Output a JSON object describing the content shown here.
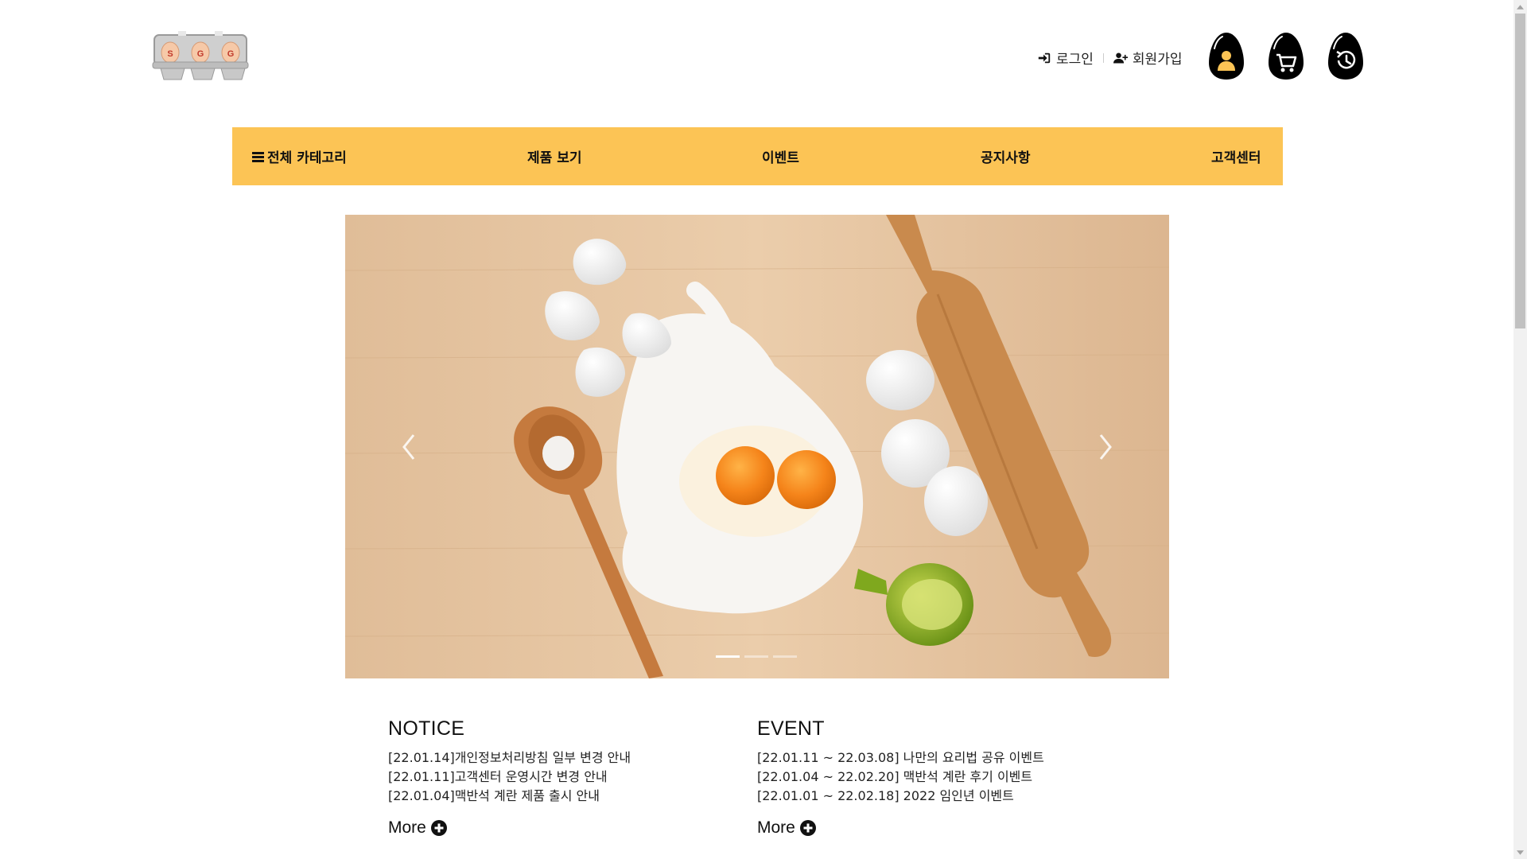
{
  "header": {
    "logo_letters": [
      "S",
      "G",
      "G"
    ],
    "login_label": "로그인",
    "signup_label": "회원가입",
    "icons": [
      "mypage-egg-icon",
      "cart-egg-icon",
      "recent-egg-icon"
    ]
  },
  "nav": {
    "all_categories": "전체 카테고리",
    "items": [
      "제품 보기",
      "이벤트",
      "공지사항",
      "고객센터"
    ]
  },
  "carousel": {
    "slide_count": 3,
    "active_index": 0
  },
  "notice": {
    "title": "NOTICE",
    "items": [
      "[22.01.14]개인정보처리방침 일부 변경 안내",
      "[22.01.11]고객센터 운영시간 변경 안내",
      "[22.01.04]맥반석 계란 제품 출시 안내"
    ],
    "more_label": "More"
  },
  "event": {
    "title": "EVENT",
    "items": [
      "[22.01.11 ~ 22.03.08] 나만의 요리법 공유 이벤트",
      "[22.01.04 ~ 22.02.20] 맥반석 계란 후기 이벤트",
      "[22.01.01 ~ 22.02.18] 2022 임인년 이벤트"
    ],
    "more_label": "More"
  },
  "colors": {
    "nav_bg": "#fcc455",
    "egg_icon": "#000000",
    "egg_icon_accent": "#fcc455"
  }
}
